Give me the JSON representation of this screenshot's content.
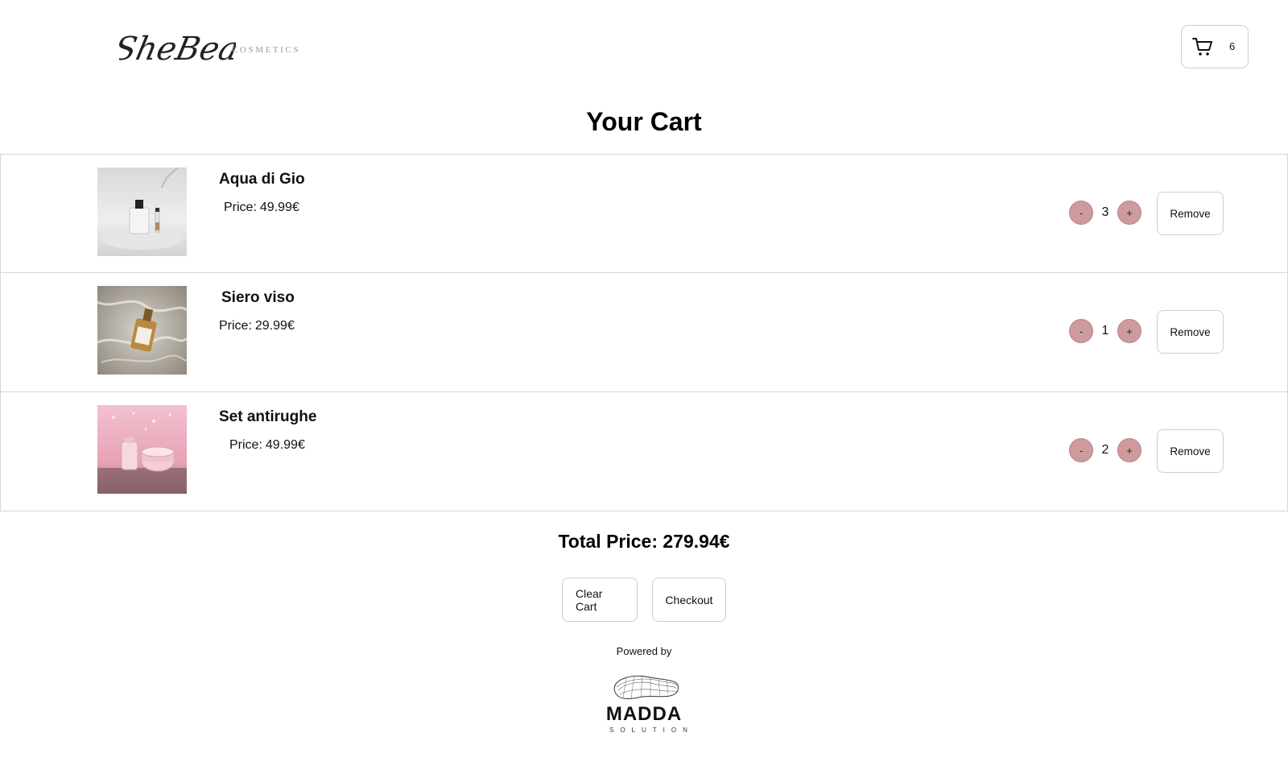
{
  "brand": {
    "logo_script_text": "SheBeauty",
    "logo_subtitle": "COSMETICS"
  },
  "header": {
    "cart_count": "6",
    "cart_icon": "shopping-cart-icon"
  },
  "page": {
    "title": "Your Cart"
  },
  "cart": {
    "price_label": "Price:",
    "items": [
      {
        "name": "Aqua di Gio",
        "price": "49.99€",
        "quantity": "3",
        "decrement_label": "-",
        "increment_label": "+",
        "remove_label": "Remove"
      },
      {
        "name": "Siero viso",
        "price": "29.99€",
        "quantity": "1",
        "decrement_label": "-",
        "increment_label": "+",
        "remove_label": "Remove"
      },
      {
        "name": "Set antirughe",
        "price": "49.99€",
        "quantity": "2",
        "decrement_label": "-",
        "increment_label": "+",
        "remove_label": "Remove"
      }
    ],
    "total_label": "Total Price: 279.94€"
  },
  "actions": {
    "clear_label": "Clear Cart",
    "checkout_label": "Checkout"
  },
  "footer": {
    "powered_by": "Powered by",
    "madda_word": "MADDA",
    "madda_sub": "SOLUTION"
  },
  "colors": {
    "qty_button": "#cf9a9b",
    "border": "#cfcfcf",
    "text": "#111111"
  }
}
